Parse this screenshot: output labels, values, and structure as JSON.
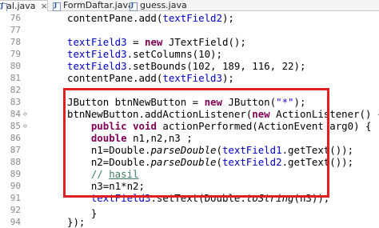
{
  "tabs": [
    {
      "label": "kal.java",
      "close": "×"
    },
    {
      "label": "FormDaftar.java"
    },
    {
      "label": "guess.java"
    }
  ],
  "lines": [
    {
      "num": "76",
      "text": "contentPane.add(textField2);"
    },
    {
      "num": "77",
      "text": ""
    },
    {
      "num": "78",
      "text": "textField3 = new JTextField();"
    },
    {
      "num": "79",
      "text": "textField3.setColumns(10);"
    },
    {
      "num": "80",
      "text": "textField3.setBounds(102, 189, 116, 22);"
    },
    {
      "num": "81",
      "text": "contentPane.add(textField3);"
    },
    {
      "num": "82",
      "text": ""
    },
    {
      "num": "83",
      "text": "JButton btnNewButton = new JButton(\"*\");"
    },
    {
      "num": "84",
      "text": "btnNewButton.addActionListener(new ActionListener() {"
    },
    {
      "num": "85",
      "text": "public void actionPerformed(ActionEvent arg0) {"
    },
    {
      "num": "86",
      "text": "double n1,n2,n3 ;"
    },
    {
      "num": "87",
      "text": "n1=Double.parseDouble(textField1.getText());"
    },
    {
      "num": "88",
      "text": "n2=Double.parseDouble(textField2.getText());"
    },
    {
      "num": "89",
      "text": "// hasil"
    },
    {
      "num": "90",
      "text": "n3=n1*n2;"
    },
    {
      "num": "91",
      "text": "textField3.setText(Double.toString(n3));"
    },
    {
      "num": "92",
      "text": ""
    },
    {
      "num": "93",
      "text": "}"
    },
    {
      "num": "94",
      "text": "});"
    }
  ],
  "colors": {
    "keyword": "#7f0055",
    "field": "#0000c0",
    "string": "#2a00ff",
    "comment": "#3f7f5f",
    "highlight_box": "#e02020"
  }
}
